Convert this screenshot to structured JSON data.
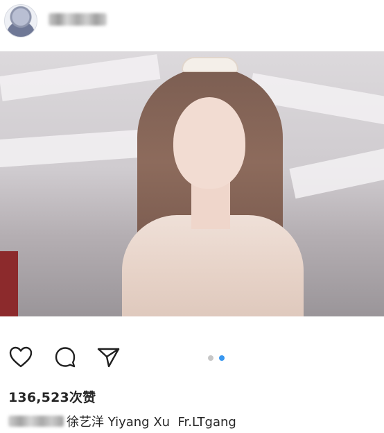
{
  "post": {
    "header": {
      "avatar_icon": "profile-avatar",
      "username": "blurred"
    },
    "photo": {
      "page_indicator": {
        "count": 2,
        "active_index": 1,
        "active_color": "#3897f0",
        "inactive_color": "#c7c7c7"
      }
    },
    "actions": {
      "like_icon": "heart-outline-icon",
      "comment_icon": "comment-bubble-icon",
      "share_icon": "send-paper-plane-icon"
    },
    "likes_text": "136,523次赞",
    "caption": {
      "username": "blurred",
      "text": "徐艺洋 Yiyang Xu  Fr.LTgang"
    }
  }
}
